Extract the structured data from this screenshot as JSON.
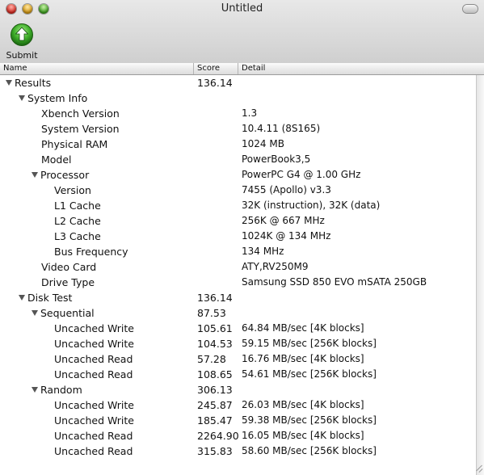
{
  "window": {
    "title": "Untitled"
  },
  "toolbar": {
    "submit_label": "Submit"
  },
  "columns": {
    "name": "Name",
    "score": "Score",
    "detail": "Detail"
  },
  "rows": [
    {
      "name": "Results",
      "score": "136.14",
      "detail": ""
    },
    {
      "name": "System Info",
      "score": "",
      "detail": ""
    },
    {
      "name": "Xbench Version",
      "score": "",
      "detail": "1.3"
    },
    {
      "name": "System Version",
      "score": "",
      "detail": "10.4.11 (8S165)"
    },
    {
      "name": "Physical RAM",
      "score": "",
      "detail": "1024 MB"
    },
    {
      "name": "Model",
      "score": "",
      "detail": "PowerBook3,5"
    },
    {
      "name": "Processor",
      "score": "",
      "detail": "PowerPC G4 @ 1.00 GHz"
    },
    {
      "name": "Version",
      "score": "",
      "detail": "7455 (Apollo) v3.3"
    },
    {
      "name": "L1 Cache",
      "score": "",
      "detail": "32K (instruction), 32K (data)"
    },
    {
      "name": "L2 Cache",
      "score": "",
      "detail": "256K @ 667 MHz"
    },
    {
      "name": "L3 Cache",
      "score": "",
      "detail": "1024K @ 134 MHz"
    },
    {
      "name": "Bus Frequency",
      "score": "",
      "detail": "134 MHz"
    },
    {
      "name": "Video Card",
      "score": "",
      "detail": "ATY,RV250M9"
    },
    {
      "name": "Drive Type",
      "score": "",
      "detail": "Samsung SSD 850 EVO mSATA 250GB"
    },
    {
      "name": "Disk Test",
      "score": "136.14",
      "detail": ""
    },
    {
      "name": "Sequential",
      "score": "87.53",
      "detail": ""
    },
    {
      "name": "Uncached Write",
      "score": "105.61",
      "detail": "64.84 MB/sec [4K blocks]"
    },
    {
      "name": "Uncached Write",
      "score": "104.53",
      "detail": "59.15 MB/sec [256K blocks]"
    },
    {
      "name": "Uncached Read",
      "score": "57.28",
      "detail": "16.76 MB/sec [4K blocks]"
    },
    {
      "name": "Uncached Read",
      "score": "108.65",
      "detail": "54.61 MB/sec [256K blocks]"
    },
    {
      "name": "Random",
      "score": "306.13",
      "detail": ""
    },
    {
      "name": "Uncached Write",
      "score": "245.87",
      "detail": "26.03 MB/sec [4K blocks]"
    },
    {
      "name": "Uncached Write",
      "score": "185.47",
      "detail": "59.38 MB/sec [256K blocks]"
    },
    {
      "name": "Uncached Read",
      "score": "2264.90",
      "detail": "16.05 MB/sec [4K blocks]"
    },
    {
      "name": "Uncached Read",
      "score": "315.83",
      "detail": "58.60 MB/sec [256K blocks]"
    }
  ]
}
